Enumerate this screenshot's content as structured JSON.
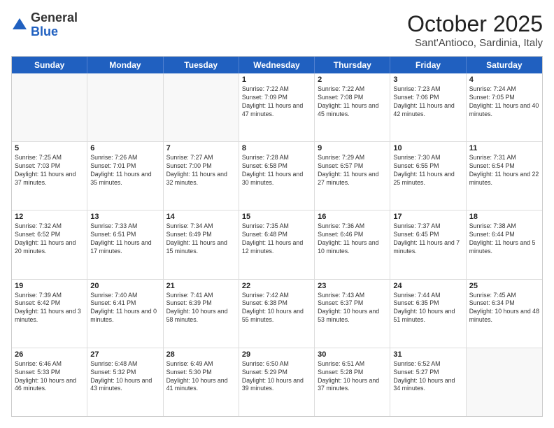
{
  "header": {
    "logo_general": "General",
    "logo_blue": "Blue",
    "month_title": "October 2025",
    "location": "Sant'Antioco, Sardinia, Italy"
  },
  "weekdays": [
    "Sunday",
    "Monday",
    "Tuesday",
    "Wednesday",
    "Thursday",
    "Friday",
    "Saturday"
  ],
  "rows": [
    [
      {
        "day": "",
        "detail": ""
      },
      {
        "day": "",
        "detail": ""
      },
      {
        "day": "",
        "detail": ""
      },
      {
        "day": "1",
        "detail": "Sunrise: 7:22 AM\nSunset: 7:09 PM\nDaylight: 11 hours and 47 minutes."
      },
      {
        "day": "2",
        "detail": "Sunrise: 7:22 AM\nSunset: 7:08 PM\nDaylight: 11 hours and 45 minutes."
      },
      {
        "day": "3",
        "detail": "Sunrise: 7:23 AM\nSunset: 7:06 PM\nDaylight: 11 hours and 42 minutes."
      },
      {
        "day": "4",
        "detail": "Sunrise: 7:24 AM\nSunset: 7:05 PM\nDaylight: 11 hours and 40 minutes."
      }
    ],
    [
      {
        "day": "5",
        "detail": "Sunrise: 7:25 AM\nSunset: 7:03 PM\nDaylight: 11 hours and 37 minutes."
      },
      {
        "day": "6",
        "detail": "Sunrise: 7:26 AM\nSunset: 7:01 PM\nDaylight: 11 hours and 35 minutes."
      },
      {
        "day": "7",
        "detail": "Sunrise: 7:27 AM\nSunset: 7:00 PM\nDaylight: 11 hours and 32 minutes."
      },
      {
        "day": "8",
        "detail": "Sunrise: 7:28 AM\nSunset: 6:58 PM\nDaylight: 11 hours and 30 minutes."
      },
      {
        "day": "9",
        "detail": "Sunrise: 7:29 AM\nSunset: 6:57 PM\nDaylight: 11 hours and 27 minutes."
      },
      {
        "day": "10",
        "detail": "Sunrise: 7:30 AM\nSunset: 6:55 PM\nDaylight: 11 hours and 25 minutes."
      },
      {
        "day": "11",
        "detail": "Sunrise: 7:31 AM\nSunset: 6:54 PM\nDaylight: 11 hours and 22 minutes."
      }
    ],
    [
      {
        "day": "12",
        "detail": "Sunrise: 7:32 AM\nSunset: 6:52 PM\nDaylight: 11 hours and 20 minutes."
      },
      {
        "day": "13",
        "detail": "Sunrise: 7:33 AM\nSunset: 6:51 PM\nDaylight: 11 hours and 17 minutes."
      },
      {
        "day": "14",
        "detail": "Sunrise: 7:34 AM\nSunset: 6:49 PM\nDaylight: 11 hours and 15 minutes."
      },
      {
        "day": "15",
        "detail": "Sunrise: 7:35 AM\nSunset: 6:48 PM\nDaylight: 11 hours and 12 minutes."
      },
      {
        "day": "16",
        "detail": "Sunrise: 7:36 AM\nSunset: 6:46 PM\nDaylight: 11 hours and 10 minutes."
      },
      {
        "day": "17",
        "detail": "Sunrise: 7:37 AM\nSunset: 6:45 PM\nDaylight: 11 hours and 7 minutes."
      },
      {
        "day": "18",
        "detail": "Sunrise: 7:38 AM\nSunset: 6:44 PM\nDaylight: 11 hours and 5 minutes."
      }
    ],
    [
      {
        "day": "19",
        "detail": "Sunrise: 7:39 AM\nSunset: 6:42 PM\nDaylight: 11 hours and 3 minutes."
      },
      {
        "day": "20",
        "detail": "Sunrise: 7:40 AM\nSunset: 6:41 PM\nDaylight: 11 hours and 0 minutes."
      },
      {
        "day": "21",
        "detail": "Sunrise: 7:41 AM\nSunset: 6:39 PM\nDaylight: 10 hours and 58 minutes."
      },
      {
        "day": "22",
        "detail": "Sunrise: 7:42 AM\nSunset: 6:38 PM\nDaylight: 10 hours and 55 minutes."
      },
      {
        "day": "23",
        "detail": "Sunrise: 7:43 AM\nSunset: 6:37 PM\nDaylight: 10 hours and 53 minutes."
      },
      {
        "day": "24",
        "detail": "Sunrise: 7:44 AM\nSunset: 6:35 PM\nDaylight: 10 hours and 51 minutes."
      },
      {
        "day": "25",
        "detail": "Sunrise: 7:45 AM\nSunset: 6:34 PM\nDaylight: 10 hours and 48 minutes."
      }
    ],
    [
      {
        "day": "26",
        "detail": "Sunrise: 6:46 AM\nSunset: 5:33 PM\nDaylight: 10 hours and 46 minutes."
      },
      {
        "day": "27",
        "detail": "Sunrise: 6:48 AM\nSunset: 5:32 PM\nDaylight: 10 hours and 43 minutes."
      },
      {
        "day": "28",
        "detail": "Sunrise: 6:49 AM\nSunset: 5:30 PM\nDaylight: 10 hours and 41 minutes."
      },
      {
        "day": "29",
        "detail": "Sunrise: 6:50 AM\nSunset: 5:29 PM\nDaylight: 10 hours and 39 minutes."
      },
      {
        "day": "30",
        "detail": "Sunrise: 6:51 AM\nSunset: 5:28 PM\nDaylight: 10 hours and 37 minutes."
      },
      {
        "day": "31",
        "detail": "Sunrise: 6:52 AM\nSunset: 5:27 PM\nDaylight: 10 hours and 34 minutes."
      },
      {
        "day": "",
        "detail": ""
      }
    ]
  ]
}
